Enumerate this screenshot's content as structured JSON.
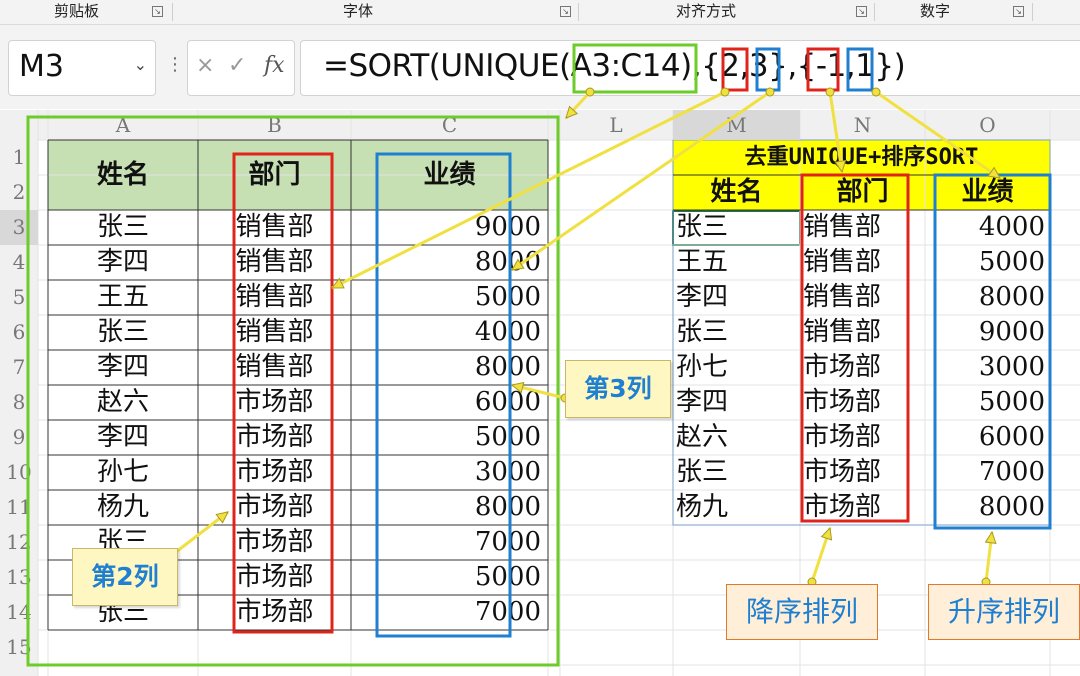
{
  "ribbon": {
    "groups": [
      "剪贴板",
      "字体",
      "对齐方式",
      "数字"
    ]
  },
  "name_box": {
    "value": "M3"
  },
  "formula_bar": {
    "cancel_icon": "×",
    "enter_icon": "✓",
    "fx_label": "fx",
    "formula": "=SORT(UNIQUE(A3:C14),{2,3},{-1,1})"
  },
  "columns": [
    "A",
    "B",
    "C",
    "L",
    "M",
    "N",
    "O"
  ],
  "rows": [
    "1",
    "2",
    "3",
    "4",
    "5",
    "6",
    "7",
    "8",
    "9",
    "10",
    "11",
    "12",
    "13",
    "14",
    "15"
  ],
  "source_table": {
    "headers": [
      "姓名",
      "部门",
      "业绩"
    ],
    "rows": [
      [
        "张三",
        "销售部",
        "9000"
      ],
      [
        "李四",
        "销售部",
        "8000"
      ],
      [
        "王五",
        "销售部",
        "5000"
      ],
      [
        "张三",
        "销售部",
        "4000"
      ],
      [
        "李四",
        "销售部",
        "8000"
      ],
      [
        "赵六",
        "市场部",
        "6000"
      ],
      [
        "李四",
        "市场部",
        "5000"
      ],
      [
        "孙七",
        "市场部",
        "3000"
      ],
      [
        "杨九",
        "市场部",
        "8000"
      ],
      [
        "张三",
        "市场部",
        "7000"
      ],
      [
        "李四",
        "市场部",
        "5000"
      ],
      [
        "张三",
        "市场部",
        "7000"
      ]
    ]
  },
  "result_table": {
    "title": "去重UNIQUE+排序SORT",
    "headers": [
      "姓名",
      "部门",
      "业绩"
    ],
    "rows": [
      [
        "张三",
        "销售部",
        "4000"
      ],
      [
        "王五",
        "销售部",
        "5000"
      ],
      [
        "李四",
        "销售部",
        "8000"
      ],
      [
        "张三",
        "销售部",
        "9000"
      ],
      [
        "孙七",
        "市场部",
        "3000"
      ],
      [
        "李四",
        "市场部",
        "5000"
      ],
      [
        "赵六",
        "市场部",
        "6000"
      ],
      [
        "张三",
        "市场部",
        "7000"
      ],
      [
        "杨九",
        "市场部",
        "8000"
      ]
    ]
  },
  "annotations": {
    "col3": "第3列",
    "col2": "第2列",
    "desc": "降序排列",
    "asc": "升序排列"
  },
  "colors": {
    "header_green": "#c6e0b4",
    "title_yellow": "#ffff00",
    "box_green": "#6ccd2a",
    "box_red": "#e0241c",
    "box_blue": "#1f7fd0",
    "arrow_yellow": "#f0e040"
  }
}
